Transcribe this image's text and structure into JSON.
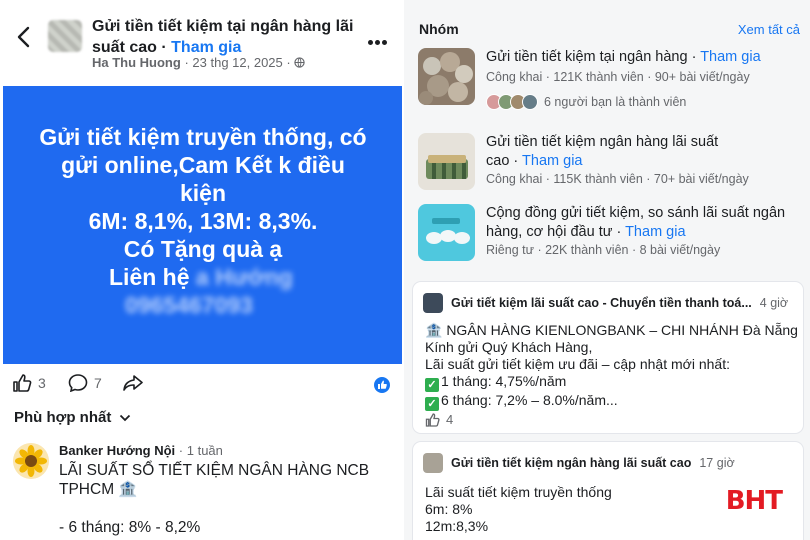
{
  "left": {
    "title": "Gửi tiền tiết kiệm tại ngân hàng lãi suất cao",
    "join": "Tham gia",
    "author": "Ha Thu Huong",
    "date": "23 thg 12, 2025",
    "image_text": {
      "line1": "Gửi tiết kiệm truyền thống, có",
      "line2": "gửi online,Cam Kết k điều",
      "line3": "kiện",
      "line4": "6M: 8,1%, 13M: 8,3%.",
      "line5": "Có Tặng quà ạ",
      "contact": "Liên hệ",
      "contact_blur": "a Hướng",
      "phone_blur": "0965467093"
    },
    "likes": "3",
    "comments": "7",
    "sort_label": "Phù hợp nhất",
    "comment": {
      "author": "Banker Hướng Nội",
      "time": "1 tuần",
      "line1": "LÃI SUẤT SỔ TIẾT KIỆM NGÂN HÀNG NCB",
      "line2": "TPHCM 🏦",
      "line3": "- 6 tháng: 8% - 8,2%"
    }
  },
  "right": {
    "groups_heading": "Nhóm",
    "see_all": "Xem tất cả",
    "groups": [
      {
        "name": "Gửi tiền tiết kiệm tại ngân hàng",
        "join": "Tham gia",
        "meta": "Công khai · 121K thành viên · 90+ bài viết/ngày",
        "friends": "6 người bạn là thành viên"
      },
      {
        "name": "Gửi tiền tiết kiệm ngân hàng lãi suất",
        "name2": "cao",
        "join": "Tham gia",
        "meta": "Công khai · 115K thành viên · 70+ bài viết/ngày"
      },
      {
        "name": "Cộng đồng gửi tiết kiệm, so sánh lãi suất ngân",
        "name2": "hàng, cơ hội đầu tư",
        "join": "Tham gia",
        "meta": "Riêng tư · 22K thành viên · 8 bài viết/ngày"
      }
    ],
    "posts": [
      {
        "group": "Gửi tiết kiệm lãi suất cao - Chuyển tiền thanh toá...",
        "time": "4 giờ",
        "line1": "🏦 NGÂN HÀNG KIENLONGBANK – CHI NHÁNH Đà Nẵng",
        "line2": "Kính gửi Quý Khách Hàng,",
        "line3": "Lãi suất gửi tiết kiệm ưu đãi – cập nhật mới nhất:",
        "line4": "1 tháng: 4,75%/năm",
        "line5": "6 tháng: 7,2% – 8.0%/năm...",
        "likes": "4"
      },
      {
        "group": "Gửi tiền tiết kiệm ngân hàng lãi suất cao",
        "time": "17 giờ",
        "line1": "Lãi suất tiết kiệm truyền thống",
        "line2": "6m: 8%",
        "line3": "12m:8,3%"
      }
    ],
    "watermark": "BHT"
  }
}
